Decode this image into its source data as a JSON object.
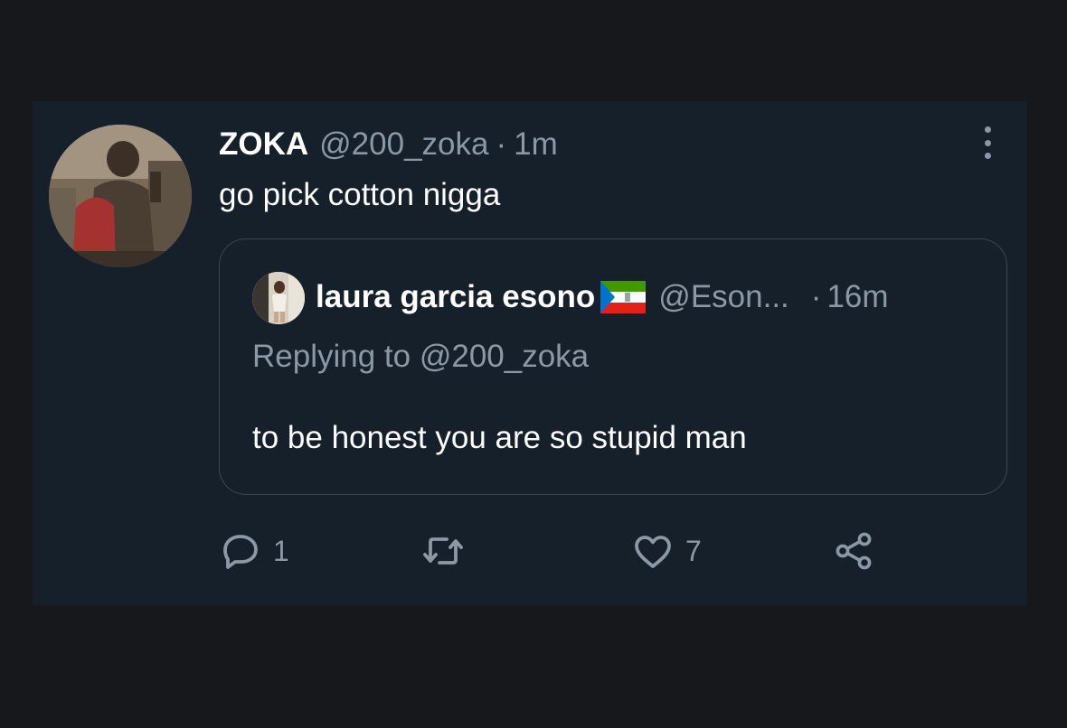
{
  "tweet": {
    "author": {
      "display_name": "ZOKA",
      "handle": "@200_zoka",
      "avatar_icon": "profile-photo-avatar"
    },
    "separator": "·",
    "time": "1m",
    "text": "go pick cotton nigga",
    "more_icon": "more-vertical-icon",
    "quoted_tweet": {
      "author": {
        "display_name": "laura garcia esono",
        "flag_icon": "equatorial-guinea-flag-icon",
        "handle": "@Eson...",
        "avatar_icon": "profile-photo-avatar"
      },
      "separator": "·",
      "time": "16m",
      "replying_to": "Replying to @200_zoka",
      "text": "to be honest you are so stupid man"
    },
    "actions": {
      "reply": {
        "icon": "reply-icon",
        "count": "1"
      },
      "retweet": {
        "icon": "retweet-icon",
        "count": ""
      },
      "like": {
        "icon": "heart-icon",
        "count": "7"
      },
      "share": {
        "icon": "share-icon",
        "count": ""
      }
    }
  },
  "colors": {
    "page_background": "#17181b",
    "card_background": "#15202b",
    "primary_text": "#ffffff",
    "secondary_text": "#8b98a5",
    "quote_border": "#3a4652"
  }
}
